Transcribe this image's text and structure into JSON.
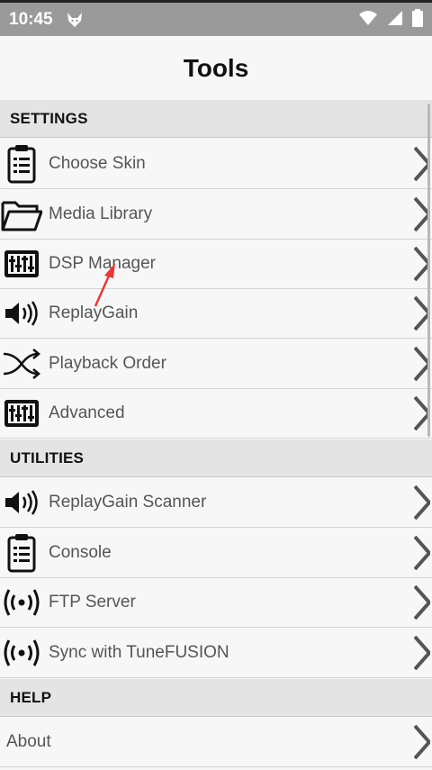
{
  "status": {
    "time": "10:45",
    "icons": [
      "fox-icon",
      "wifi-icon",
      "signal-icon",
      "battery-icon"
    ]
  },
  "header": {
    "title": "Tools"
  },
  "sections": [
    {
      "title": "SETTINGS",
      "items": [
        {
          "label": "Choose Skin",
          "icon": "clipboard-icon"
        },
        {
          "label": "Media Library",
          "icon": "folder-icon"
        },
        {
          "label": "DSP Manager",
          "icon": "equalizer-icon"
        },
        {
          "label": "ReplayGain",
          "icon": "speaker-icon"
        },
        {
          "label": "Playback Order",
          "icon": "shuffle-icon"
        },
        {
          "label": "Advanced",
          "icon": "equalizer-icon"
        }
      ]
    },
    {
      "title": "UTILITIES",
      "items": [
        {
          "label": "ReplayGain Scanner",
          "icon": "speaker-icon"
        },
        {
          "label": "Console",
          "icon": "clipboard-icon"
        },
        {
          "label": "FTP Server",
          "icon": "broadcast-icon"
        },
        {
          "label": "Sync with TuneFUSION",
          "icon": "broadcast-icon"
        }
      ]
    },
    {
      "title": "HELP",
      "items": [
        {
          "label": "About",
          "icon": ""
        }
      ]
    }
  ],
  "colors": {
    "status_bar": "#9a9a9a",
    "background": "#f7f7f7",
    "section_header": "#e4e4e4",
    "annotation_arrow": "#e53935"
  }
}
